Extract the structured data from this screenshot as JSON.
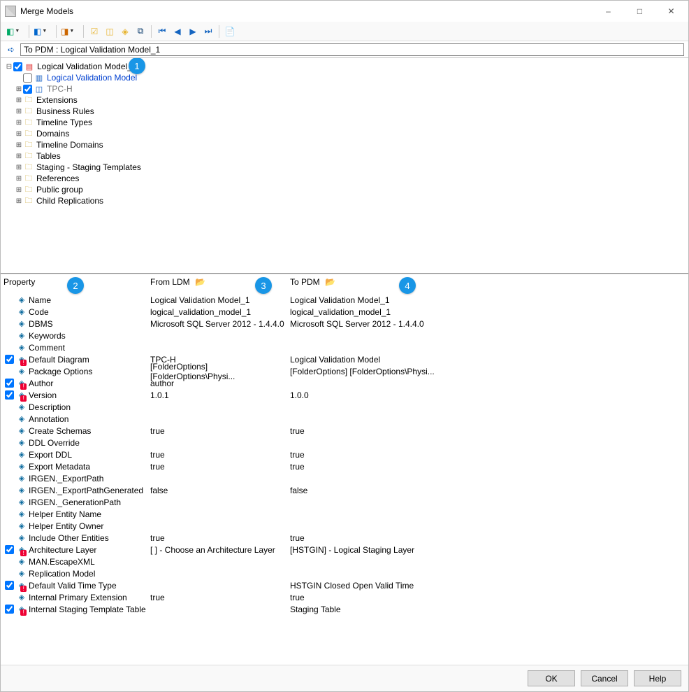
{
  "window": {
    "title": "Merge Models"
  },
  "location": "To PDM : Logical Validation Model_1",
  "tree": {
    "root": {
      "label": "Logical Validation Model_1",
      "checked": true
    },
    "child_model": {
      "label": "Logical Validation Model",
      "checked": false
    },
    "tpch": {
      "label": "TPC-H",
      "checked": true
    },
    "items": [
      {
        "label": "Extensions"
      },
      {
        "label": "Business Rules"
      },
      {
        "label": "Timeline Types"
      },
      {
        "label": "Domains"
      },
      {
        "label": "Timeline Domains"
      },
      {
        "label": "Tables"
      },
      {
        "label": "Staging - Staging Templates"
      },
      {
        "label": "References"
      },
      {
        "label": "Public group"
      },
      {
        "label": "Child Replications"
      }
    ]
  },
  "bullets": {
    "b1": "1",
    "b2": "2",
    "b3": "3",
    "b4": "4"
  },
  "prop_headers": {
    "property": "Property",
    "from": "From LDM",
    "to": "To PDM"
  },
  "props": [
    {
      "ck": null,
      "icon": "prop",
      "name": "Name",
      "from": "Logical Validation Model_1",
      "to": "Logical Validation Model_1"
    },
    {
      "ck": null,
      "icon": "prop",
      "name": "Code",
      "from": "logical_validation_model_1",
      "to": "logical_validation_model_1"
    },
    {
      "ck": null,
      "icon": "prop",
      "name": "DBMS",
      "from": "Microsoft SQL Server 2012 - 1.4.4.0",
      "to": "Microsoft SQL Server 2012 - 1.4.4.0"
    },
    {
      "ck": null,
      "icon": "prop",
      "name": "Keywords",
      "from": "",
      "to": ""
    },
    {
      "ck": null,
      "icon": "prop",
      "name": "Comment",
      "from": "",
      "to": ""
    },
    {
      "ck": true,
      "icon": "warn",
      "name": "Default Diagram",
      "from": "TPC-H",
      "to": "Logical Validation Model"
    },
    {
      "ck": null,
      "icon": "prop",
      "name": "Package Options",
      "from": "[FolderOptions]  [FolderOptions\\Physi...",
      "to": "[FolderOptions]  [FolderOptions\\Physi..."
    },
    {
      "ck": true,
      "icon": "warn",
      "name": "Author",
      "from": "author",
      "to": ""
    },
    {
      "ck": true,
      "icon": "warn",
      "name": "Version",
      "from": "1.0.1",
      "to": "1.0.0"
    },
    {
      "ck": null,
      "icon": "prop",
      "name": "Description",
      "from": "",
      "to": ""
    },
    {
      "ck": null,
      "icon": "prop",
      "name": "Annotation",
      "from": "",
      "to": ""
    },
    {
      "ck": null,
      "icon": "prop",
      "name": "Create Schemas",
      "from": "true",
      "to": "true"
    },
    {
      "ck": null,
      "icon": "prop",
      "name": "DDL Override",
      "from": "",
      "to": ""
    },
    {
      "ck": null,
      "icon": "prop",
      "name": "Export DDL",
      "from": "true",
      "to": "true"
    },
    {
      "ck": null,
      "icon": "prop",
      "name": "Export Metadata",
      "from": "true",
      "to": "true"
    },
    {
      "ck": null,
      "icon": "prop",
      "name": "IRGEN._ExportPath",
      "from": "",
      "to": ""
    },
    {
      "ck": null,
      "icon": "prop",
      "name": "IRGEN._ExportPathGenerated",
      "from": "false",
      "to": "false"
    },
    {
      "ck": null,
      "icon": "prop",
      "name": "IRGEN._GenerationPath",
      "from": "",
      "to": ""
    },
    {
      "ck": null,
      "icon": "prop",
      "name": "Helper Entity Name",
      "from": "",
      "to": ""
    },
    {
      "ck": null,
      "icon": "prop",
      "name": "Helper Entity Owner",
      "from": "",
      "to": ""
    },
    {
      "ck": null,
      "icon": "prop",
      "name": "Include Other Entities",
      "from": "true",
      "to": "true"
    },
    {
      "ck": true,
      "icon": "warn",
      "name": "Architecture Layer",
      "from": "[      ] - Choose an Architecture Layer",
      "to": "[HSTGIN] - Logical Staging Layer"
    },
    {
      "ck": null,
      "icon": "prop",
      "name": "MAN.EscapeXML",
      "from": "",
      "to": ""
    },
    {
      "ck": null,
      "icon": "prop",
      "name": "Replication Model",
      "from": "",
      "to": ""
    },
    {
      "ck": true,
      "icon": "warn",
      "name": "Default Valid Time Type",
      "from": "",
      "to": "HSTGIN Closed Open Valid Time"
    },
    {
      "ck": null,
      "icon": "prop",
      "name": "Internal Primary Extension",
      "from": "true",
      "to": "true"
    },
    {
      "ck": true,
      "icon": "warn",
      "name": "Internal Staging Template Table",
      "from": "",
      "to": "Staging Table"
    }
  ],
  "buttons": {
    "ok": "OK",
    "cancel": "Cancel",
    "help": "Help"
  }
}
